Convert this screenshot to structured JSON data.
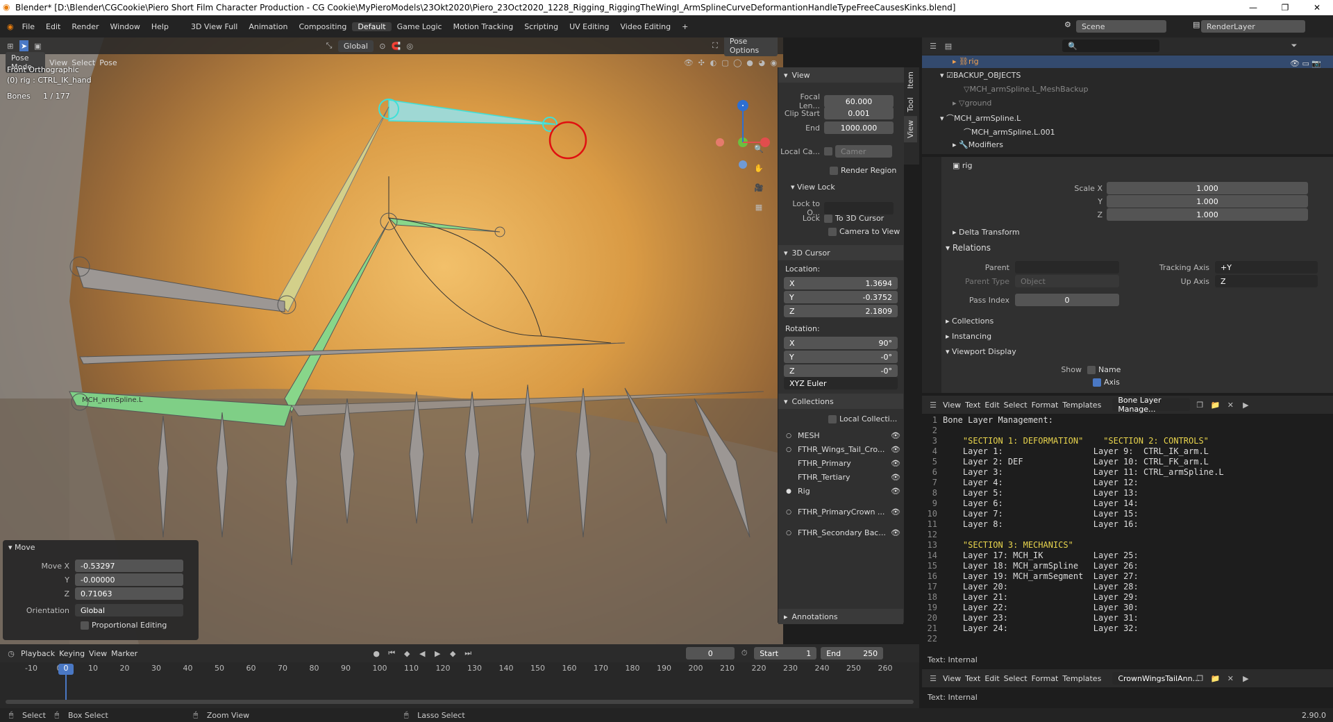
{
  "window": {
    "title": "Blender* [D:\\Blender\\CGCookie\\Piero Short Film Character Production - CG Cookie\\MyPieroModels\\23Okt2020\\Piero_23Oct2020_1228_Rigging_RiggingTheWingI_ArmSplineCurveDeformantionHandleTypeFreeCausesKinks.blend]"
  },
  "menu": [
    "File",
    "Edit",
    "Render",
    "Window",
    "Help"
  ],
  "workspaces": [
    "3D View Full",
    "Animation",
    "Compositing",
    "Default",
    "Game Logic",
    "Motion Tracking",
    "Scripting",
    "UV Editing",
    "Video Editing"
  ],
  "scene": "Scene",
  "render_layer": "RenderLayer",
  "viewport": {
    "mode": "Pose Mode",
    "menus": [
      "View",
      "Select",
      "Pose"
    ],
    "orientation": "Global",
    "pose_options": "Pose Options",
    "info1": "Front Orthographic",
    "info2": "(0) rig : CTRL_IK_hand",
    "bones_label": "Bones",
    "bones_value": "1 / 177",
    "bone_labels": [
      "MCH_armSpline.L"
    ]
  },
  "n_panel": {
    "tabs": [
      "Item",
      "Tool",
      "View"
    ],
    "view_title": "View",
    "focal_label": "Focal Len...",
    "focal": "60.000",
    "clip_start_label": "Clip Start",
    "clip_start": "0.001",
    "end_label": "End",
    "end": "1000.000",
    "local_cam_label": "Local Ca...",
    "local_cam": "Camer",
    "render_region": "Render Region",
    "view_lock_title": "View Lock",
    "lock_to_label": "Lock to O...",
    "lock_label": "Lock",
    "to_3d_cursor": "To 3D Cursor",
    "camera_to_view": "Camera to View",
    "cursor_title": "3D Cursor",
    "location_label": "Location:",
    "loc": [
      {
        "a": "X",
        "v": "1.3694"
      },
      {
        "a": "Y",
        "v": "-0.3752"
      },
      {
        "a": "Z",
        "v": "2.1809"
      }
    ],
    "rotation_label": "Rotation:",
    "rot": [
      {
        "a": "X",
        "v": "90°"
      },
      {
        "a": "Y",
        "v": "-0°"
      },
      {
        "a": "Z",
        "v": "-0°"
      }
    ],
    "rot_mode": "XYZ Euler",
    "collections_title": "Collections",
    "local_collections": "Local Collecti...",
    "collections": [
      "MESH",
      "FTHR_Wings_Tail_Cro...",
      "FTHR_Primary",
      "FTHR_Tertiary",
      "Rig",
      "FTHR_PrimaryCrown ...",
      "FTHR_Secondary Bac..."
    ],
    "annotations_title": "Annotations"
  },
  "move_panel": {
    "title": "Move",
    "x_label": "Move X",
    "x": "-0.53297",
    "y_label": "Y",
    "y": "-0.00000",
    "z_label": "Z",
    "z": "0.71063",
    "orient_label": "Orientation",
    "orient": "Global",
    "proportional": "Proportional Editing"
  },
  "outliner": {
    "items": [
      "rig",
      "BACKUP_OBJECTS",
      "MCH_armSpline.L_MeshBackup",
      "ground",
      "MCH_armSpline.L",
      "MCH_armSpline.L.001",
      "Modifiers"
    ]
  },
  "properties": {
    "object": "rig",
    "scale_x_label": "Scale X",
    "scale_x": "1.000",
    "y_label": "Y",
    "y": "1.000",
    "z_label": "Z",
    "z": "1.000",
    "delta": "Delta Transform",
    "relations": "Relations",
    "parent_label": "Parent",
    "parent_type_label": "Parent Type",
    "parent_type": "Object",
    "tracking_axis_label": "Tracking Axis",
    "tracking_axis": "+Y",
    "up_axis_label": "Up Axis",
    "up_axis": "Z",
    "pass_index_label": "Pass Index",
    "pass_index": "0",
    "collections": "Collections",
    "instancing": "Instancing",
    "viewport_display": "Viewport Display",
    "show_label": "Show",
    "name": "Name",
    "axis": "Axis"
  },
  "text_editor": {
    "menus": [
      "View",
      "Text",
      "Edit",
      "Select",
      "Format",
      "Templates"
    ],
    "doc": "Bone Layer Manage...",
    "status": "Text: Internal",
    "lines": [
      "Bone Layer Management:",
      "",
      "    \"SECTION 1: DEFORMATION\"    \"SECTION 2: CONTROLS\"",
      "    Layer 1:                  Layer 9:  CTRL_IK_arm.L",
      "    Layer 2: DEF              Layer 10: CTRL_FK_arm.L",
      "    Layer 3:                  Layer 11: CTRL_armSpline.L",
      "    Layer 4:                  Layer 12:",
      "    Layer 5:                  Layer 13:",
      "    Layer 6:                  Layer 14:",
      "    Layer 7:                  Layer 15:",
      "    Layer 8:                  Layer 16:",
      "",
      "    \"SECTION 3: MECHANICS\"",
      "    Layer 17: MCH_IK          Layer 25:",
      "    Layer 18: MCH_armSpline   Layer 26:",
      "    Layer 19: MCH_armSegment  Layer 27:",
      "    Layer 20:                 Layer 28:",
      "    Layer 21:                 Layer 29:",
      "    Layer 22:                 Layer 30:",
      "    Layer 23:                 Layer 31:",
      "    Layer 24:                 Layer 32:",
      "",
      ""
    ]
  },
  "text_editor2": {
    "menus": [
      "View",
      "Text",
      "Edit",
      "Select",
      "Format",
      "Templates"
    ],
    "doc": "CrownWingsTailAnn...",
    "status": "Text: Internal"
  },
  "timeline": {
    "menus": [
      "Playback",
      "Keying",
      "View",
      "Marker"
    ],
    "frame": "0",
    "start_label": "Start",
    "start": "1",
    "end_label": "End",
    "end": "250",
    "current": "0",
    "ticks": [
      "-10",
      "0",
      "10",
      "20",
      "30",
      "40",
      "50",
      "60",
      "70",
      "80",
      "90",
      "100",
      "110",
      "120",
      "130",
      "140",
      "150",
      "160",
      "170",
      "180",
      "190",
      "200",
      "210",
      "220",
      "230",
      "240",
      "250",
      "260"
    ]
  },
  "statusbar": {
    "select": "Select",
    "box_select": "Box Select",
    "zoom_view": "Zoom View",
    "lasso_select": "Lasso Select",
    "version": "2.90.0"
  }
}
